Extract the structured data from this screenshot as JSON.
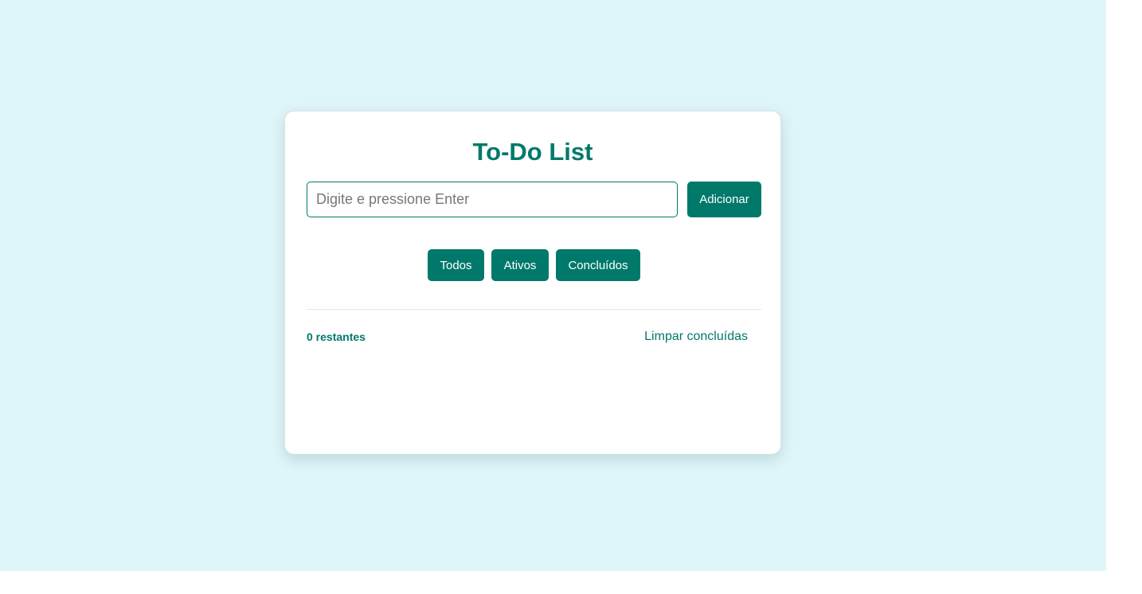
{
  "app": {
    "title": "To-Do List"
  },
  "input": {
    "value": "",
    "placeholder": "Digite e pressione Enter"
  },
  "actions": {
    "add_label": "Adicionar",
    "clear_completed_label": "Limpar concluídas"
  },
  "filters": [
    {
      "label": "Todos"
    },
    {
      "label": "Ativos"
    },
    {
      "label": "Concluídos"
    }
  ],
  "footer": {
    "remaining": "0 restantes"
  },
  "colors": {
    "background": "#dff6f9",
    "accent": "#00796b",
    "card": "#ffffff"
  }
}
